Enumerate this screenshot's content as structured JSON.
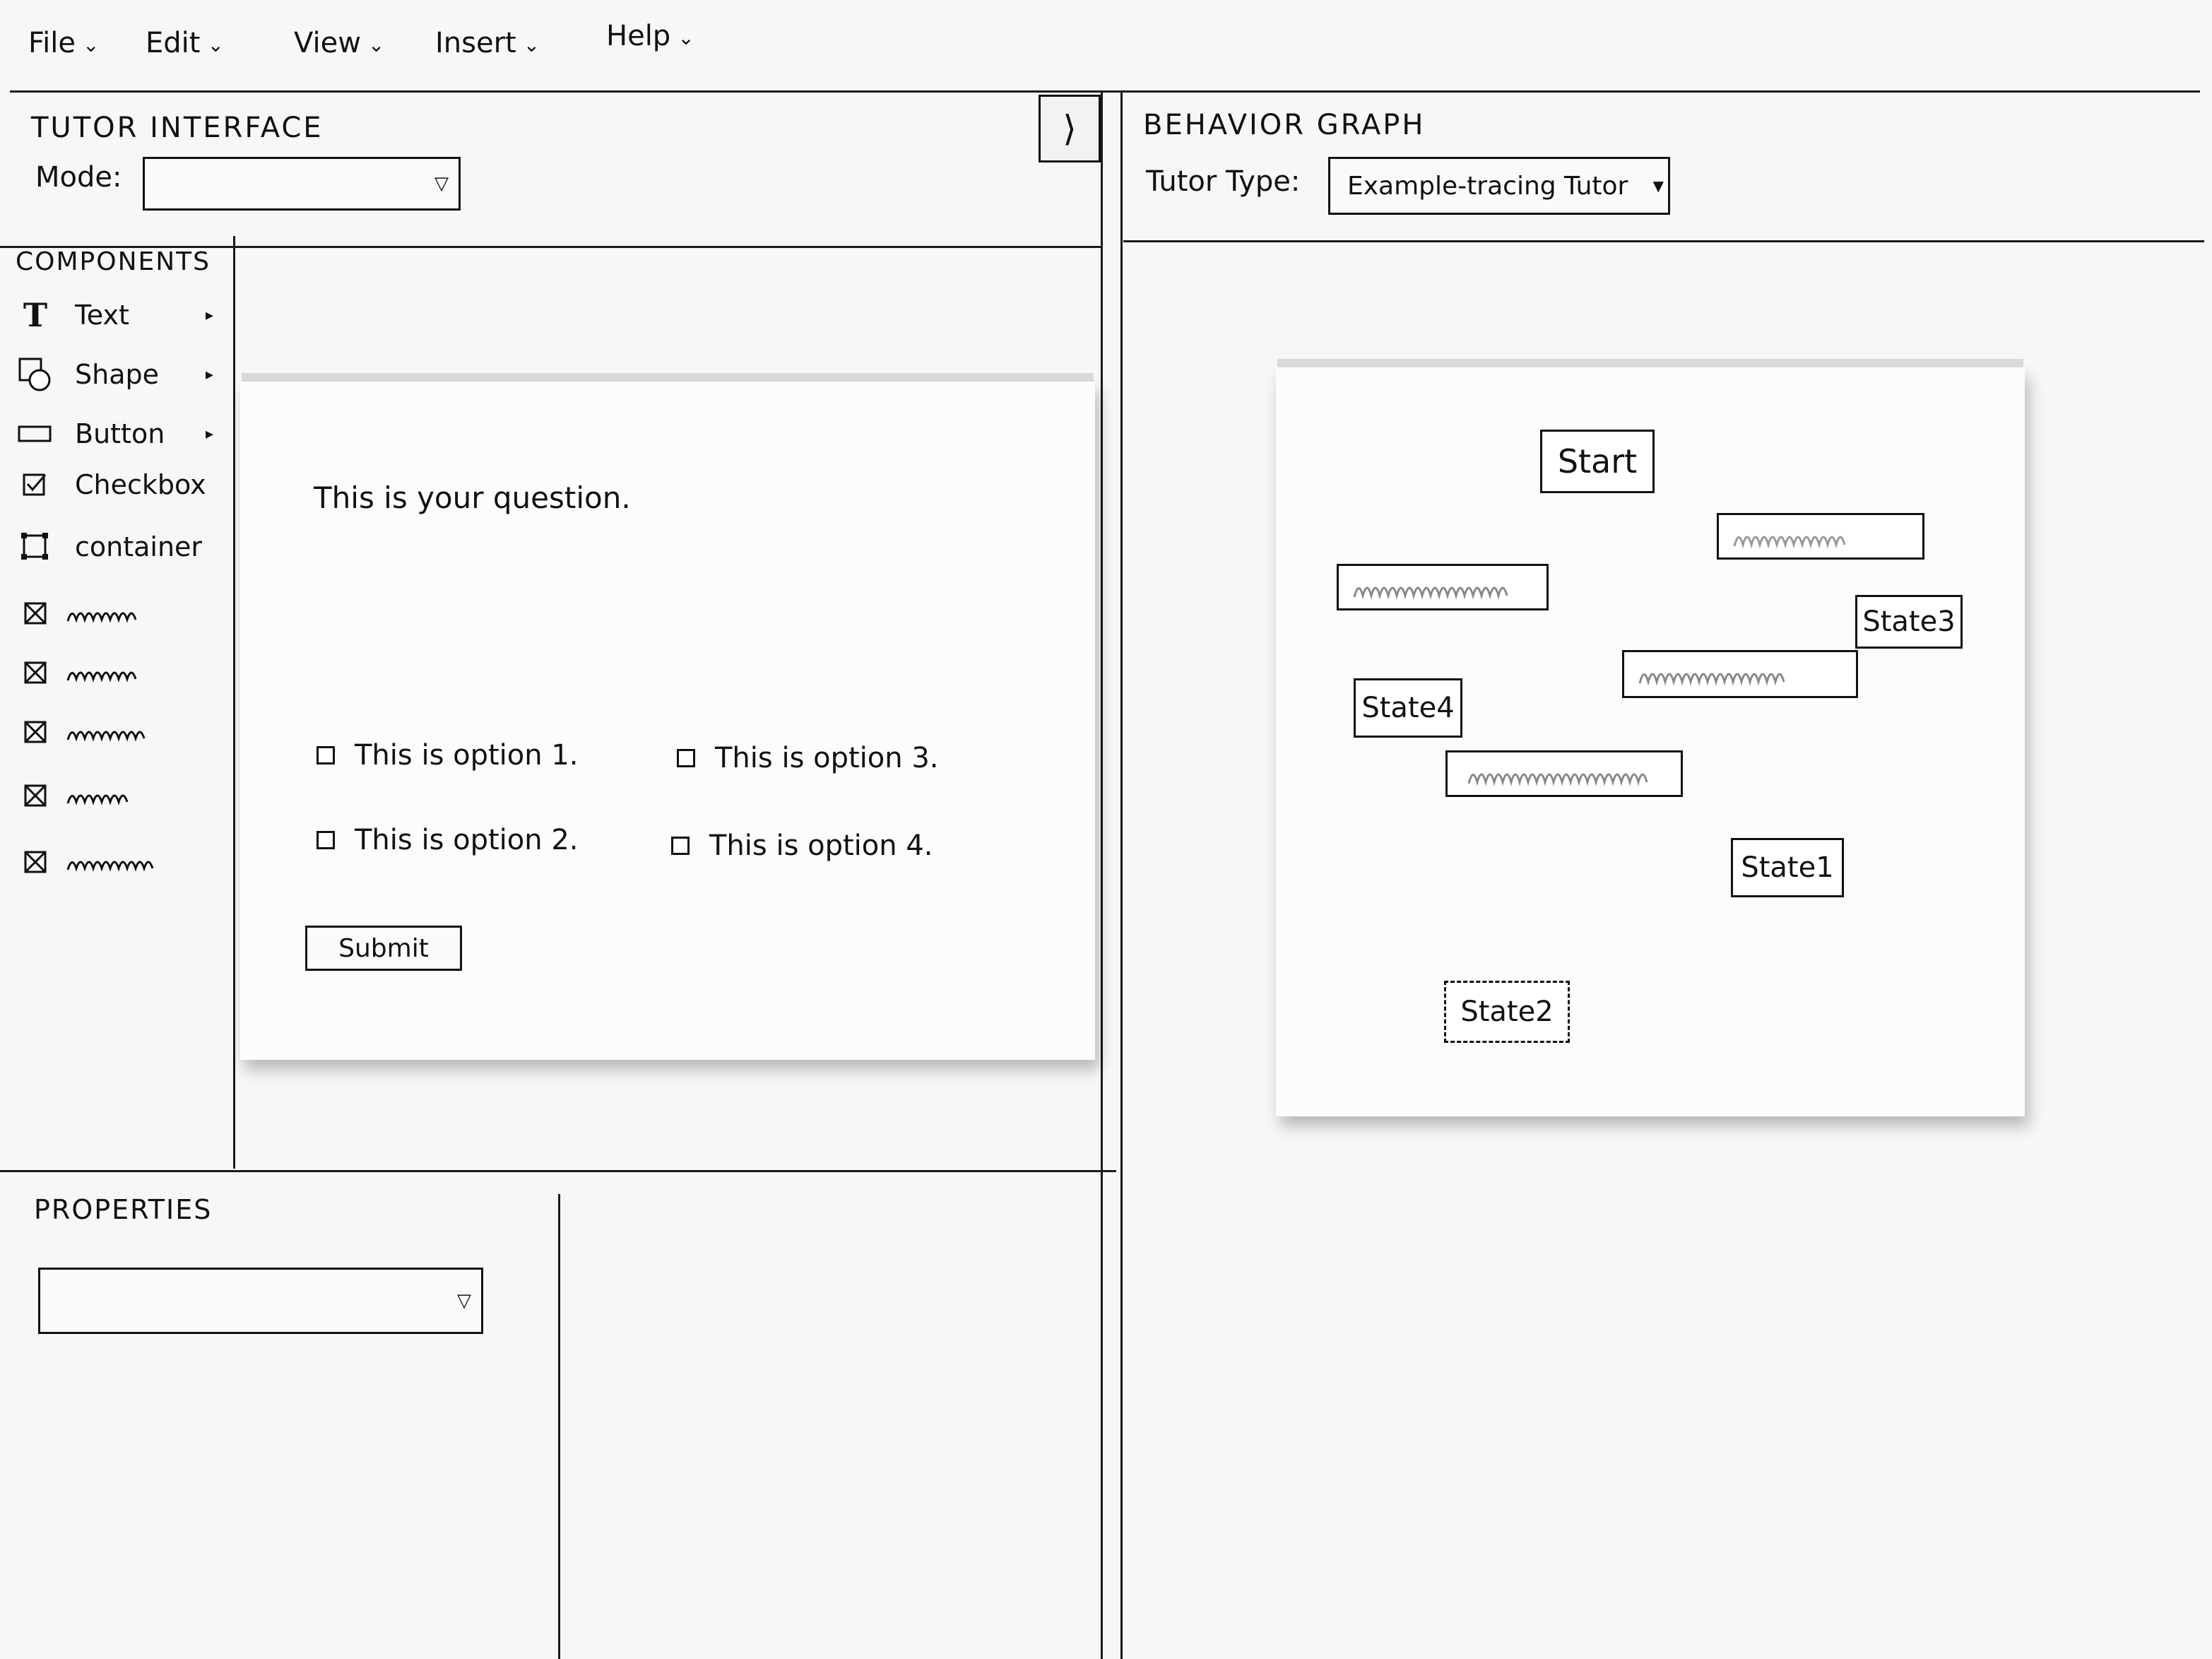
{
  "menu": {
    "file": "File",
    "edit": "Edit",
    "view": "View",
    "insert": "Insert",
    "help": "Help"
  },
  "tutor_interface": {
    "title": "TUTOR INTERFACE",
    "mode_label": "Mode:",
    "mode_value": ""
  },
  "behavior_graph": {
    "title": "BEHAVIOR GRAPH",
    "tutor_type_label": "Tutor Type:",
    "tutor_type_value": "Example-tracing Tutor",
    "nodes": {
      "start": "Start",
      "state1": "State1",
      "state2": "State2",
      "state3": "State3",
      "state4": "State4"
    }
  },
  "components": {
    "title": "COMPONENTS",
    "items": [
      {
        "label": "Text",
        "icon": "text-icon"
      },
      {
        "label": "Shape",
        "icon": "shape-icon"
      },
      {
        "label": "Button",
        "icon": "button-icon"
      },
      {
        "label": "Checkbox",
        "icon": "checkbox-icon"
      },
      {
        "label": "container",
        "icon": "container-icon"
      }
    ]
  },
  "canvas": {
    "question": "This is your question.",
    "options": [
      "This is option 1.",
      "This is option 2.",
      "This is option 3.",
      "This is option 4."
    ],
    "submit": "Submit"
  },
  "properties": {
    "title": "PROPERTIES",
    "select_value": ""
  }
}
